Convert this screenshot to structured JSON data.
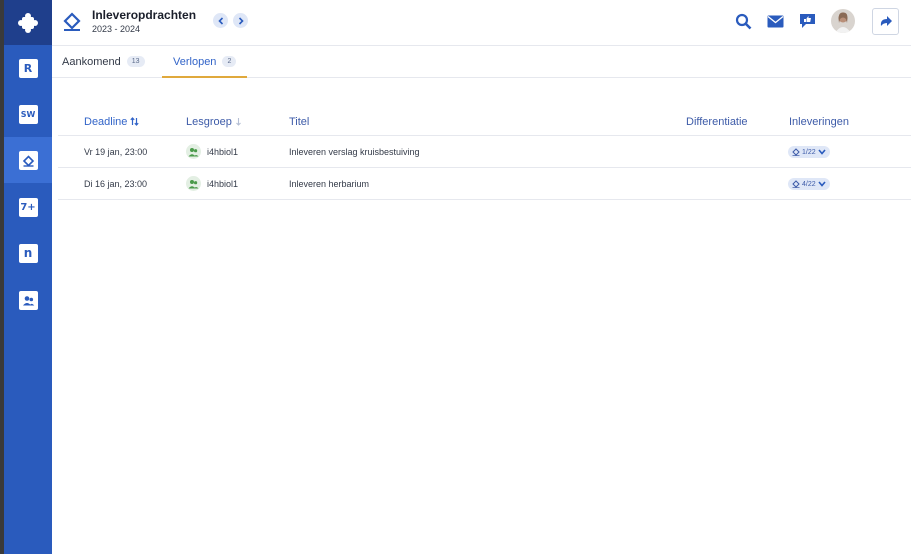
{
  "app": {
    "title": "Inleveropdrachten",
    "subtitle": "2023 - 2024"
  },
  "colors": {
    "sidebar": "#2a5bbd",
    "sidebar_active": "#3b6fd4",
    "accent": "#3264c8",
    "tab_underline": "#e0a93c"
  },
  "sidebar": {
    "logo_icon": "puzzle-icon",
    "items": [
      {
        "name": "roster",
        "glyph": "R"
      },
      {
        "name": "studiewijzer",
        "glyph": "SW"
      },
      {
        "name": "inleveropdrachten",
        "glyph": "",
        "active": true
      },
      {
        "name": "cijfers",
        "glyph": "7+"
      },
      {
        "name": "notities",
        "glyph": "n"
      },
      {
        "name": "groepen",
        "glyph": ""
      }
    ]
  },
  "tabs": [
    {
      "label": "Aankomend",
      "count": "13"
    },
    {
      "label": "Verlopen",
      "count": "2",
      "active": true
    }
  ],
  "table": {
    "headers": {
      "deadline": "Deadline",
      "lesgroep": "Lesgroep",
      "titel": "Titel",
      "differentiatie": "Differentiatie",
      "inleveringen": "Inleveringen"
    },
    "rows": [
      {
        "deadline": "Vr 19 jan, 23:00",
        "lesgroep": "i4hbiol1",
        "titel": "Inleveren verslag kruisbestuiving",
        "differentiatie": "",
        "inleveringen": "1/22"
      },
      {
        "deadline": "Di 16 jan, 23:00",
        "lesgroep": "i4hbiol1",
        "titel": "Inleveren herbarium",
        "differentiatie": "",
        "inleveringen": "4/22"
      }
    ]
  }
}
